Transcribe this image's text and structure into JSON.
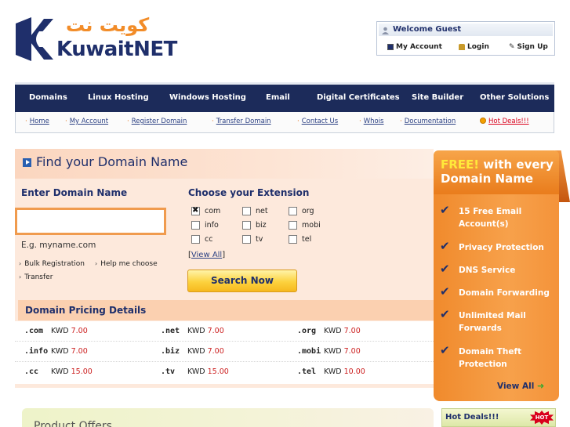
{
  "header": {
    "logo_arabic": "كويت نت",
    "logo_latin_kuwait": "Kuwait",
    "logo_latin_net": "NET",
    "welcome": "Welcome Guest",
    "my_account": "My Account",
    "login": "Login",
    "sign_up": "Sign Up"
  },
  "nav": {
    "items": [
      "Domains",
      "Linux Hosting",
      "Windows Hosting",
      "Email",
      "Digital Certificates",
      "Site Builder",
      "Other Solutions"
    ]
  },
  "subnav": {
    "items": [
      "Home",
      "My Account",
      "Register Domain",
      "Transfer Domain",
      "Contact Us",
      "Whois",
      "Documentation"
    ],
    "hot_deals": "Hot Deals!!!"
  },
  "domain_search": {
    "title": "Find your Domain Name",
    "enter_label": "Enter Domain Name",
    "input_value": "",
    "example": "E.g. myname.com",
    "links": [
      "Bulk Registration",
      "Help me choose",
      "Transfer"
    ],
    "ext_label": "Choose your Extension",
    "extensions": [
      {
        "name": "com",
        "checked": true
      },
      {
        "name": "net",
        "checked": false
      },
      {
        "name": "org",
        "checked": false
      },
      {
        "name": "info",
        "checked": false
      },
      {
        "name": "biz",
        "checked": false
      },
      {
        "name": "mobi",
        "checked": false
      },
      {
        "name": "cc",
        "checked": false
      },
      {
        "name": "tv",
        "checked": false
      },
      {
        "name": "tel",
        "checked": false
      }
    ],
    "view_all": "View All",
    "search_button": "Search Now"
  },
  "pricing": {
    "title": "Domain Pricing Details",
    "currency": "KWD",
    "rows": [
      [
        {
          "tld": ".com",
          "price": "7.00"
        },
        {
          "tld": ".net",
          "price": "7.00"
        },
        {
          "tld": ".org",
          "price": "7.00"
        }
      ],
      [
        {
          "tld": ".info",
          "price": "7.00"
        },
        {
          "tld": ".biz",
          "price": "7.00"
        },
        {
          "tld": ".mobi",
          "price": "7.00"
        }
      ],
      [
        {
          "tld": ".cc",
          "price": "15.00"
        },
        {
          "tld": ".tv",
          "price": "15.00"
        },
        {
          "tld": ".tel",
          "price": "10.00"
        }
      ]
    ]
  },
  "free_panel": {
    "free_word": "FREE!",
    "line1_rest": " with every",
    "line2": "Domain Name",
    "features": [
      "15 Free Email Account(s)",
      "Privacy Protection",
      "DNS Service",
      "Domain Forwarding",
      "Unlimited Mail Forwards",
      "Domain Theft Protection"
    ],
    "view_all": "View All"
  },
  "bottom": {
    "banner_text": "Product Offers",
    "hot_deals": "Hot Deals!!!",
    "hot_badge": "HOT"
  },
  "colors": {
    "navy": "#1c2b5a",
    "orange": "#f08a2c",
    "price_red": "#cc1f1f"
  }
}
